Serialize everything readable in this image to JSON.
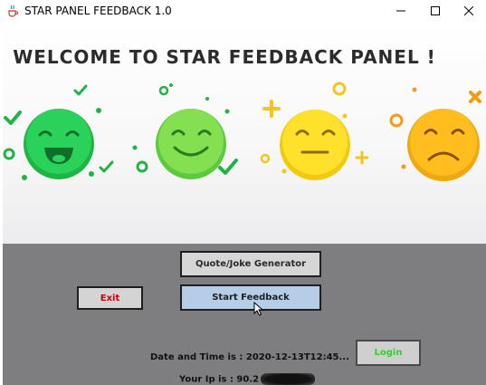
{
  "window": {
    "title": "STAR PANEL FEEDBACK 1.0",
    "controls": {
      "minimize": "—",
      "maximize": "☐",
      "close": "✕"
    }
  },
  "hero": {
    "heading": "WELCOME TO STAR FEEDBACK PANEL !",
    "faces": [
      "very-happy-face",
      "happy-face",
      "neutral-face",
      "sad-face"
    ],
    "colors": {
      "very_happy": "#22c24a",
      "happy": "#7fdc4a",
      "neutral": "#f7d51a",
      "sad": "#f6b316",
      "mark_green": "#1fb545",
      "mark_yellow": "#f5c518",
      "mark_orange": "#f39c12"
    }
  },
  "buttons": {
    "quote_joke": "Quote/Joke Generator",
    "start_feedback": "Start Feedback",
    "exit": "Exit",
    "login": "Login"
  },
  "info": {
    "date_time": "Date and Time is : 2020-12-13T12:45...",
    "ip": "Your Ip is : 90.2"
  },
  "colors": {
    "panel_bg": "#7e7d80",
    "start_bg": "#b5cde6",
    "exit_text": "#cc0000",
    "login_text": "#2fd02f"
  }
}
